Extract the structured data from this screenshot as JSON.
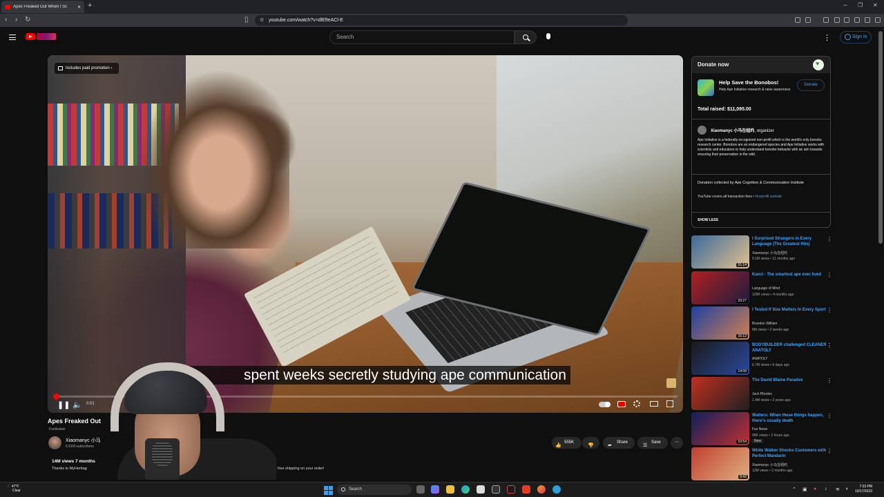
{
  "browser": {
    "tab_title": "Apes Freaked Out When I Sc",
    "url": "youtube.com/watch?v=dlEfteACl-E",
    "new_tab_symbol": "+",
    "close_symbol": "✕"
  },
  "youtube": {
    "search_placeholder": "Search",
    "sign_in": "Sign in"
  },
  "video": {
    "promo_label": "Includes paid promotion",
    "caption": "spent weeks secretly studying ape communication",
    "current_time": "0:01",
    "progress": 0.003,
    "title": "Apes Freaked Out",
    "badge": "Fundraiser",
    "channel": "Xiaomanyc 小马",
    "subscribers": "6.91M subscribers",
    "views_date": "14M views  7 months",
    "desc_line": "Thanks to MyHeritag",
    "coupon_text": "use coupon code XIAO for free shipping on your order!",
    "likes": "555K",
    "share": "Share",
    "save": "Save"
  },
  "donate": {
    "header": "Donate now",
    "title": "Help Save the Bonobos!",
    "subtitle": "Help Ape Initiative research & raise awareness",
    "button": "Donate",
    "total": "Total raised: $11,095.00",
    "organizer": "Xiaomanyc 小马在纽约",
    "organizer_role": ", organizer",
    "description": "Ape Initiative is a federally-recognized non-profit which is the world's only bonobo research center. Bonobos are an endangered species and Ape Initiative works with scientists and educators to help understand bonobo behavior with an aim towards ensuring their preservation in the wild.",
    "collected_by": "Donation collected by Ape Cognition & Communication Institute",
    "fees": "YouTube covers all transaction fees",
    "nonprofit_link": "Nonprofit website",
    "show_less": "SHOW LESS"
  },
  "recommendations": [
    {
      "title": "I Surprised Strangers in Every Language (The Greatest Hits)",
      "channel": "Xiaomanyc 小马在纽约",
      "meta": "9.1M views • 11 months ago",
      "duration": "51:14",
      "colors": [
        "#3a6a9a",
        "#e2c090"
      ]
    },
    {
      "title": "Kanzi - The smartest ape ever lived",
      "channel": "Language of Mind",
      "meta": "129K views • 4 months ago",
      "duration": "29:27",
      "colors": [
        "#b02020",
        "#1c1c40"
      ]
    },
    {
      "title": "I Tested If Size Matters In Every Sport",
      "channel": "Brandon William",
      "meta": "8M views • 2 weeks ago",
      "duration": "16:12",
      "colors": [
        "#2040a0",
        "#d08050"
      ]
    },
    {
      "title": "BODYBUILDER challenged CLEANER ANATOLY",
      "channel": "ANATOLY",
      "meta": "6.7M views • 6 days ago",
      "duration": "14:09",
      "colors": [
        "#1a1a1a",
        "#2a4aa0"
      ]
    },
    {
      "title": "The David Blaine Paradox",
      "channel": "Jack Rhodes",
      "meta": "1.4M views • 2 years ago",
      "duration": "",
      "colors": [
        "#c03020",
        "#202020"
      ]
    },
    {
      "title": "Watters: When these things happen, there's usually death",
      "channel": "Fox News",
      "meta": "95K views • 2 hours ago",
      "duration": "10:54",
      "colors": [
        "#10205a",
        "#c03030"
      ],
      "badge": "New"
    },
    {
      "title": "White Walker Shocks Customers with Perfect Mandarin",
      "channel": "Xiaomanyc 小马在纽约",
      "meta": "12M views • 2 months ago",
      "duration": "9:42",
      "colors": [
        "#c04030",
        "#e0b080"
      ]
    }
  ],
  "taskbar": {
    "temperature": "47°F",
    "condition": "Clear",
    "search": "Search",
    "time": "7:03 PM",
    "date": "10/17/2023"
  }
}
